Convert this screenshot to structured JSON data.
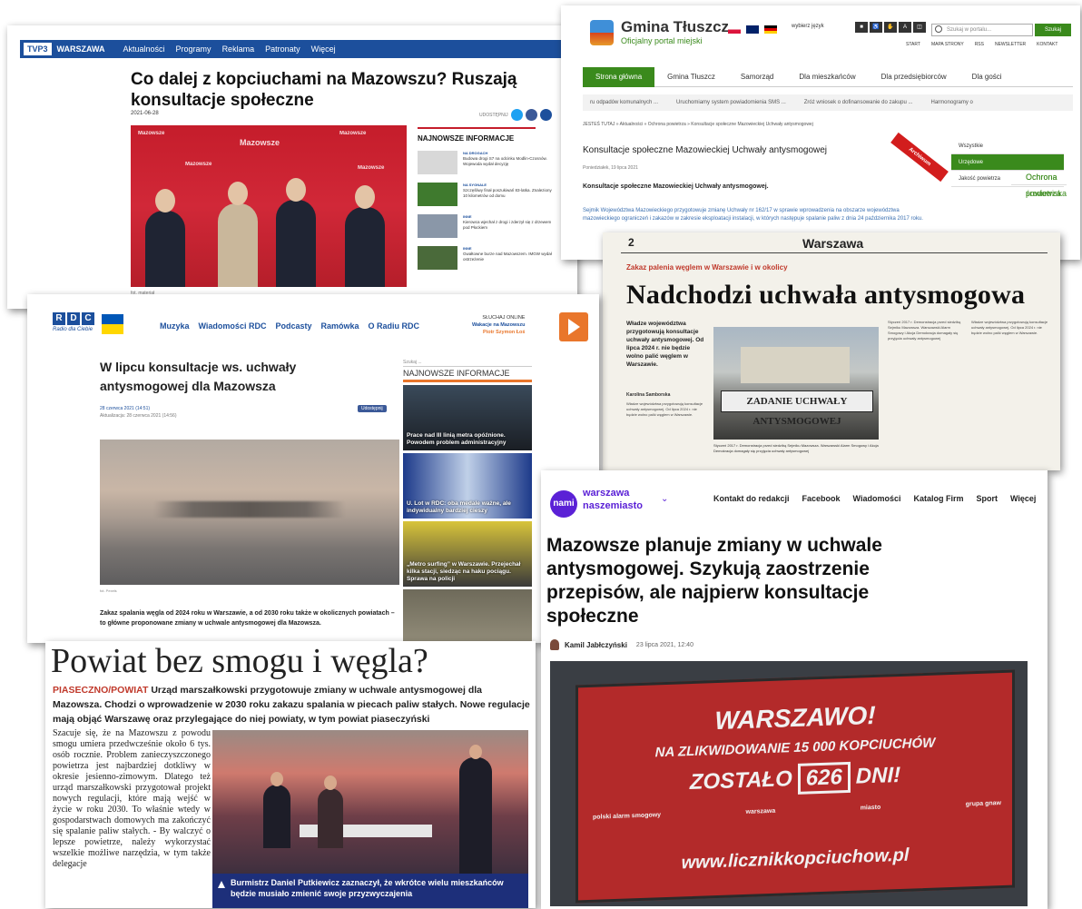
{
  "tvp": {
    "logo": "TVP3",
    "city": "WARSZAWA",
    "nav": [
      "Aktualności",
      "Programy",
      "Reklama",
      "Patronaty",
      "Więcej"
    ],
    "title": "Co dalej z kopciuchami na Mazowszu? Ruszają konsultacje społeczne",
    "date": "2021-06-28",
    "share_label": "UDOSTĘPNIJ",
    "photo_brand": "Mazowsze",
    "sidebar_header": "NAJNOWSZE INFORMACJE",
    "news": [
      {
        "tag": "NA DROGACH",
        "text": "Budowa drogi S7 na odcinku Modlin-Czosnów. Wojewoda wydał decyzję"
      },
      {
        "tag": "NA SYGNALE",
        "text": "Szczęśliwy finał poszukiwań 83-latka. Znaleziony 10 kilometrów od domu"
      },
      {
        "tag": "INNE",
        "text": "Kierowca wjechał z drogi i zderzył się z drzewem pod Płockiem"
      },
      {
        "tag": "INNE",
        "text": "Gwałtowne burze nad Mazowszem. IMGW wydał ostrzeżenie"
      }
    ],
    "caption": "fot. materiał"
  },
  "gmina": {
    "title": "Gmina Tłuszcz",
    "subtitle": "Oficjalny portal miejski",
    "lang": "wybierz język",
    "search_placeholder": "Szukaj w portalu...",
    "search_button": "Szukaj",
    "toplinks": [
      "START",
      "MAPA STRONY",
      "RSS",
      "NEWSLETTER",
      "KONTAKT"
    ],
    "menu": [
      "Strona główna",
      "Gmina Tłuszcz",
      "Samorząd",
      "Dla mieszkańców",
      "Dla przedsiębiorców",
      "Dla gości"
    ],
    "ticker": [
      "ru odpadów komunalnych ...",
      "Uruchomiamy system powiadomienia SMS ...",
      "Zróż wniosek o dofinansowanie do zakupu ...",
      "Harmonogramy o"
    ],
    "breadcrumb": "JESTEŚ TUTAJ » Aktualności » Ochrona powietrza » Konsultacje społeczne Mazowieckiej Uchwały antysmogowej",
    "article_title": "Konsultacje społeczne Mazowieckiej Uchwały antysmogowej",
    "article_date": "Poniedziałek, 19 lipca 2021",
    "article_lead": "Konsultacje społeczne Mazowieckiej Uchwały antysmogowej.",
    "article_body": "Sejmik Województwa Mazowieckiego przygotowuje zmianę Uchwały nr 162/17 w sprawie wprowadzenia na obszarze województwa mazowieckiego ograniczeń i zakazów w zakresie eksploatacji instalacji, w których następuje spalanie paliw z dnia 24 października 2017 roku.",
    "ribbon": "Archiwum",
    "sidenav": [
      "Wszystkie",
      "Urzędowe",
      "Ochrona środowiska",
      "Ochrona powietrza",
      "Jakość powietrza"
    ]
  },
  "paper": {
    "page_num": "2",
    "section": "Warszawa",
    "kicker": "Zakaz palenia węglem w Warszawie i w okolicy",
    "headline": "Nadchodzi uchwała antysmogowa",
    "lead": "Władze województwa przygotowują konsultacje uchwały antysmogowej. Od lipca 2024 r. nie będzie wolno palić węglem w Warszawie.",
    "author": "Karolina Samborska",
    "banner": "ZADANIE UCHWAŁY ANTYSMOGOWEJ",
    "caption": "Styczeń 2017 r. Demonstracja przed siedzibą Sejmiku Mazowsza. Warszawski Alarm Smogowy i Akcja Demokracja domagały się przyjęcia uchwały antysmogowej"
  },
  "rdc": {
    "logo": [
      "R",
      "D",
      "C"
    ],
    "logo_sub": "Radio dla Ciebie",
    "nav": [
      "Muzyka",
      "Wiadomości RDC",
      "Podcasty",
      "Ramówka",
      "O Radiu RDC"
    ],
    "live_label": "SŁUCHAJ ONLINE",
    "live_show": "Wakacje na Mazowszu",
    "live_host": "Piotr Szymon Łoś",
    "title": "W lipcu konsultacje ws. uchwały antysmogowej dla Mazowsza",
    "published": "28 czerwca 2021 (14:51)",
    "updated": "Aktualizacja: 28 czerwca 2021 (14:56)",
    "share": "Udostępnij",
    "credit": "fot. Pexels",
    "body": "Zakaz spalania węgla od 2024 roku w Warszawie, a od 2030 roku także w okolicznych powiatach – to główne proponowane zmiany w uchwale antysmogowej dla Mazowsza.",
    "search": "Szukaj ...",
    "sidebar_header": "NAJNOWSZE INFORMACJE",
    "tiles": [
      "Prace nad III linią metra opóźnione. Powodem problem administracyjny",
      "U. Lot w RDC: oba medale ważne, ale indywidualny bardziej cieszy",
      "„Metro surfing” w Warszawie. Przejechał kilka stacji, siedząc na haku pociągu. Sprawa na policji",
      ""
    ]
  },
  "powiat": {
    "headline": "Powiat bez smogu i węgla?",
    "place": "PIASECZNO/POWIAT",
    "lead": "Urząd marszałkowski przygotowuje zmiany w uchwale antysmogowej dla Mazowsza. Chodzi o wprowadzenie w 2030 roku zakazu spalania w piecach paliw stałych. Nowe regulacje mają objąć Warszawę oraz przylegające do niej powiaty, w tym powiat piaseczyński",
    "text": "Szacuje się, że na Mazowszu z powodu smogu umiera przedwcześnie około 6 tys. osób rocznie. Problem zanieczyszczonego powietrza jest najbardziej dotkliwy w okresie jesienno-zimowym. Dlatego też urząd marszałkowski przygotował projekt nowych regulacji, które mają wejść w życie w roku 2030. To właśnie wtedy w gospodarstwach domowych ma zakończyć się spalanie paliw stałych. - By walczyć o lepsze powietrze, należy wykorzystać wszelkie możliwe narzędzia, w tym także delegacje",
    "caption": "Burmistrz Daniel Putkiewicz zaznaczył, że wkrótce wielu mieszkańców będzie musiało zmienić swoje przyzwyczajenia"
  },
  "nasze": {
    "logo": "nami",
    "brand_line1": "warszawa",
    "brand_line2": "naszemiasto",
    "nav": [
      "Kontakt do redakcji",
      "Facebook",
      "Wiadomości",
      "Katalog Firm",
      "Sport",
      "Więcej"
    ],
    "title": "Mazowsze planuje zmiany w uchwale antysmogowej. Szykują zaostrzenie przepisów, ale najpierw konsultacje społeczne",
    "author": "Kamil Jabłczyński",
    "date": "23 lipca 2021, 12:40",
    "board_line1": "WARSZAWO!",
    "board_line2": "NA ZLIKWIDOWANIE 15 000 KOPCIUCHÓW",
    "board_line3a": "ZOSTAŁO",
    "board_count": "626",
    "board_line3b": "DNI!",
    "board_logos": [
      "polski alarm smogowy",
      "warszawa",
      "miasto",
      "grupa gnaw"
    ],
    "board_url": "www.licznikkopciuchow.pl"
  },
  "colors": {
    "tvp_blue": "#1c4f9c",
    "gmina_green": "#3a8a1c",
    "rdc_orange": "#e9762b",
    "nami_purple": "#5b21d6",
    "board_red": "#b32a2a"
  }
}
